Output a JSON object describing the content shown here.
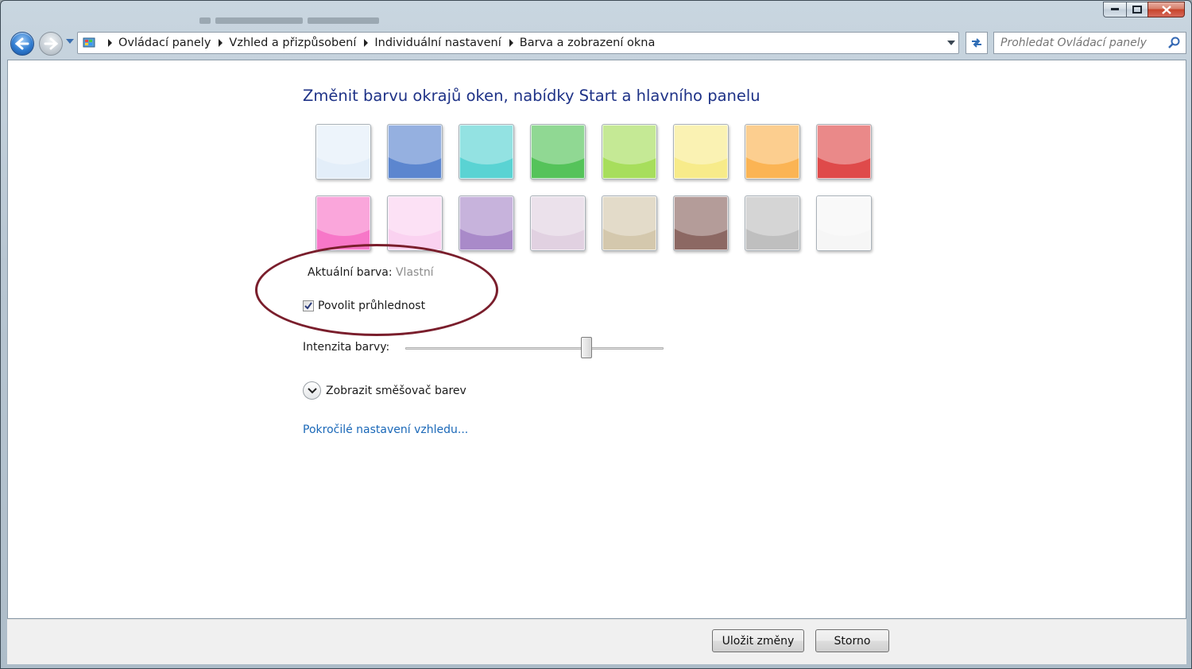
{
  "address": {
    "breadcrumbs": [
      "Ovládací panely",
      "Vzhled a přizpůsobení",
      "Individuální nastavení",
      "Barva a zobrazení okna"
    ]
  },
  "search": {
    "placeholder": "Prohledat Ovládací panely"
  },
  "main": {
    "heading": "Změnit barvu okrajů oken, nabídky Start a hlavního panelu",
    "current_color_label": "Aktuální barva:",
    "current_color_value": "Vlastní",
    "transparency_label": "Povolit průhlednost",
    "transparency_checked": true,
    "intensity_label": "Intenzita barvy:",
    "intensity_level": 0.7,
    "mixer_label": "Zobrazit směšovač barev",
    "advanced_link": "Pokročilé nastavení vzhledu..."
  },
  "swatches": [
    {
      "name": "sky",
      "color": "#e3eef9"
    },
    {
      "name": "twilight",
      "color": "#5c86cf"
    },
    {
      "name": "sea",
      "color": "#5ad3d3"
    },
    {
      "name": "leaf",
      "color": "#55c35a"
    },
    {
      "name": "lime",
      "color": "#a7de5c"
    },
    {
      "name": "sun",
      "color": "#f7eb8a"
    },
    {
      "name": "pumpkin",
      "color": "#fbb454"
    },
    {
      "name": "ruby",
      "color": "#df4a4a"
    },
    {
      "name": "fuchsia",
      "color": "#f777c8"
    },
    {
      "name": "blush",
      "color": "#fad2f0"
    },
    {
      "name": "violet",
      "color": "#a98ac9"
    },
    {
      "name": "lavender",
      "color": "#e1d1e1"
    },
    {
      "name": "taupe",
      "color": "#d4c8ad"
    },
    {
      "name": "chocolate",
      "color": "#8c6863"
    },
    {
      "name": "slate",
      "color": "#bfbfbf"
    },
    {
      "name": "frost",
      "color": "#f6f6f6"
    }
  ],
  "footer": {
    "save_label": "Uložit změny",
    "cancel_label": "Storno"
  },
  "colors": {
    "heading": "#1e3287",
    "link": "#1a68b8",
    "annotation": "#7a1e2c"
  },
  "icons": [
    "back-icon",
    "forward-icon",
    "control-panel-icon",
    "refresh-icon",
    "search-icon",
    "chevron-down-icon",
    "check-icon",
    "minimize-icon",
    "maximize-icon",
    "close-icon"
  ]
}
